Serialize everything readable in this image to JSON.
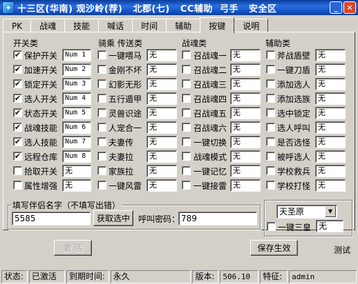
{
  "window": {
    "title": "十三区(华南) 观沙岭(荐)   北郡(七)   CC辅助  弓手   安全区"
  },
  "tabs": [
    "PK",
    "战魂",
    "技能",
    "喊话",
    "时间",
    "辅助",
    "按键",
    "说明"
  ],
  "active_tab": "按键",
  "columns": {
    "switches": {
      "header": "开关类",
      "items": [
        {
          "label": "保护开关",
          "checked": true,
          "value": "Num 1"
        },
        {
          "label": "加速开关",
          "checked": true,
          "value": "Num 2"
        },
        {
          "label": "锁定开关",
          "checked": true,
          "value": "Num 3"
        },
        {
          "label": "选人开关",
          "checked": true,
          "value": "Num 4"
        },
        {
          "label": "状态开关",
          "checked": true,
          "value": "Num 5"
        },
        {
          "label": "战魂技能",
          "checked": true,
          "value": "Num 6"
        },
        {
          "label": "选人技能",
          "checked": true,
          "value": "Num 7"
        },
        {
          "label": "远程仓库",
          "checked": true,
          "value": "Num 8"
        },
        {
          "label": "拾取开关",
          "checked": false,
          "value": "无"
        },
        {
          "label": "属性增强",
          "checked": false,
          "value": "无"
        }
      ]
    },
    "mounts": {
      "header": "骑乘 传送类",
      "items": [
        {
          "label": "一键喂马",
          "checked": false,
          "value": "无"
        },
        {
          "label": "金刚不坏",
          "checked": false,
          "value": "无"
        },
        {
          "label": "幻影无形",
          "checked": false,
          "value": "无"
        },
        {
          "label": "五行遁甲",
          "checked": false,
          "value": "无"
        },
        {
          "label": "灵兽识途",
          "checked": false,
          "value": "无"
        },
        {
          "label": "人宠合一",
          "checked": false,
          "value": "无"
        },
        {
          "label": "夫妻传",
          "checked": false,
          "value": "无"
        },
        {
          "label": "夫妻拉",
          "checked": false,
          "value": "无"
        },
        {
          "label": "家族拉",
          "checked": false,
          "value": "无"
        },
        {
          "label": "一键风雷",
          "checked": false,
          "value": "无"
        }
      ]
    },
    "souls": {
      "header": "战魂类",
      "items": [
        {
          "label": "召战魂一",
          "checked": false,
          "value": "无"
        },
        {
          "label": "召战魂二",
          "checked": false,
          "value": "无"
        },
        {
          "label": "召战魂三",
          "checked": false,
          "value": "无"
        },
        {
          "label": "召战魂四",
          "checked": false,
          "value": "无"
        },
        {
          "label": "召战魂五",
          "checked": false,
          "value": "无"
        },
        {
          "label": "召战魂六",
          "checked": false,
          "value": "无"
        },
        {
          "label": "一键切换",
          "checked": false,
          "value": "无"
        },
        {
          "label": "战魂模式",
          "checked": false,
          "value": "无"
        },
        {
          "label": "一键记忆",
          "checked": false,
          "value": "无"
        },
        {
          "label": "一键接雷",
          "checked": false,
          "value": "无"
        }
      ]
    },
    "assist": {
      "header": "辅助类",
      "items": [
        {
          "label": "斧战盾壁",
          "checked": false,
          "value": "无"
        },
        {
          "label": "一键刀盾",
          "checked": false,
          "value": "无"
        },
        {
          "label": "添加选人",
          "checked": false,
          "value": "无"
        },
        {
          "label": "添加选族",
          "checked": false,
          "value": "无"
        },
        {
          "label": "选中锁定",
          "checked": false,
          "value": "无"
        },
        {
          "label": "选人呼叫",
          "checked": false,
          "value": "无"
        },
        {
          "label": "是否选怪",
          "checked": false,
          "value": "无"
        },
        {
          "label": "被呼选人",
          "checked": false,
          "value": "无"
        },
        {
          "label": "学校救兵",
          "checked": false,
          "value": "无"
        },
        {
          "label": "学校打怪",
          "checked": false,
          "value": "无"
        }
      ]
    }
  },
  "partner": {
    "group_label": "填写伴侣名字（不填写出错）",
    "name_value": "5585",
    "get_button": "获取选中",
    "password_label": "呼叫密码：",
    "password_value": "789"
  },
  "location": {
    "selected": "天圣原",
    "checkbox_label": "一键三皇",
    "checked": false,
    "value": "无"
  },
  "buttons": {
    "activate": "激 活",
    "save": "保存生效"
  },
  "test_label": "测试",
  "statusbar": {
    "status_label": "状态:",
    "status_value": "已激活",
    "expire_label": "到期时间:",
    "expire_value": "永久",
    "version_label": "版本:",
    "version_value": "506.10",
    "feature_label": "特征:",
    "feature_value": "admin"
  },
  "colors": {
    "titlebar": "#1e5fd4",
    "face": "#d4d0c8"
  }
}
